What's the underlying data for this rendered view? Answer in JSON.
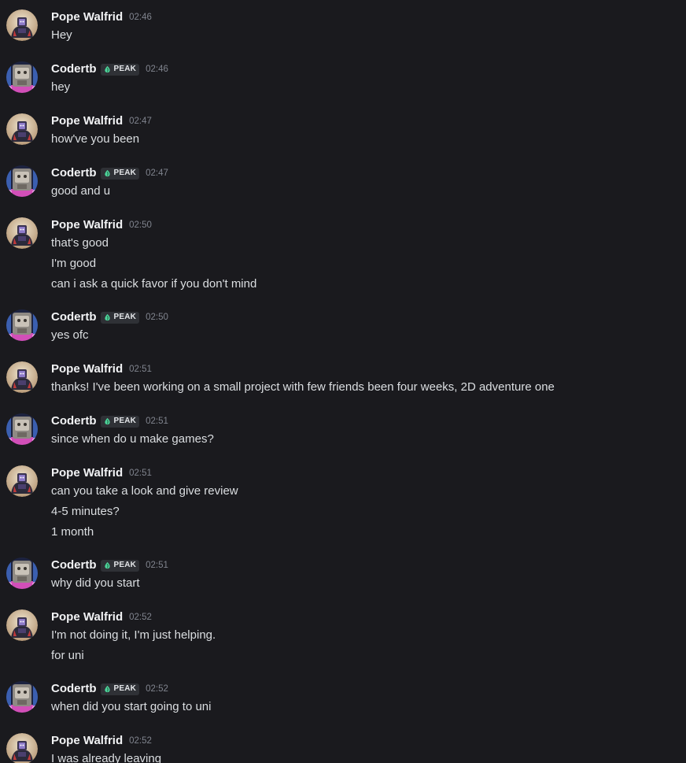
{
  "users": {
    "pope": {
      "name": "Pope Walfrid",
      "avatar_icon": "pope-avatar-icon"
    },
    "coder": {
      "name": "Codertb",
      "tag": "PEAK",
      "tag_icon": "leaf-flame-icon",
      "tag_color": "#4dd69b",
      "avatar_icon": "coder-avatar-icon"
    }
  },
  "messages": [
    {
      "user": "pope",
      "time": "02:46",
      "lines": [
        "Hey"
      ]
    },
    {
      "user": "coder",
      "time": "02:46",
      "lines": [
        "hey"
      ]
    },
    {
      "user": "pope",
      "time": "02:47",
      "lines": [
        "how've you been"
      ]
    },
    {
      "user": "coder",
      "time": "02:47",
      "lines": [
        "good and u"
      ]
    },
    {
      "user": "pope",
      "time": "02:50",
      "lines": [
        "that's good",
        "I'm good",
        "can i ask a quick favor if you don't mind"
      ]
    },
    {
      "user": "coder",
      "time": "02:50",
      "lines": [
        "yes ofc"
      ]
    },
    {
      "user": "pope",
      "time": "02:51",
      "lines": [
        "thanks! I've been working on a small project with few friends been four weeks, 2D adventure one"
      ]
    },
    {
      "user": "coder",
      "time": "02:51",
      "lines": [
        "since when do u make games?"
      ]
    },
    {
      "user": "pope",
      "time": "02:51",
      "lines": [
        "can you take a look and give review",
        "4-5 minutes?",
        "1 month"
      ]
    },
    {
      "user": "coder",
      "time": "02:51",
      "lines": [
        "why did you start"
      ]
    },
    {
      "user": "pope",
      "time": "02:52",
      "lines": [
        "I'm not doing it, I'm just helping.",
        "for uni"
      ]
    },
    {
      "user": "coder",
      "time": "02:52",
      "lines": [
        "when did you start going to uni"
      ]
    },
    {
      "user": "pope",
      "time": "02:52",
      "lines": [
        "I was already leaving"
      ]
    }
  ]
}
